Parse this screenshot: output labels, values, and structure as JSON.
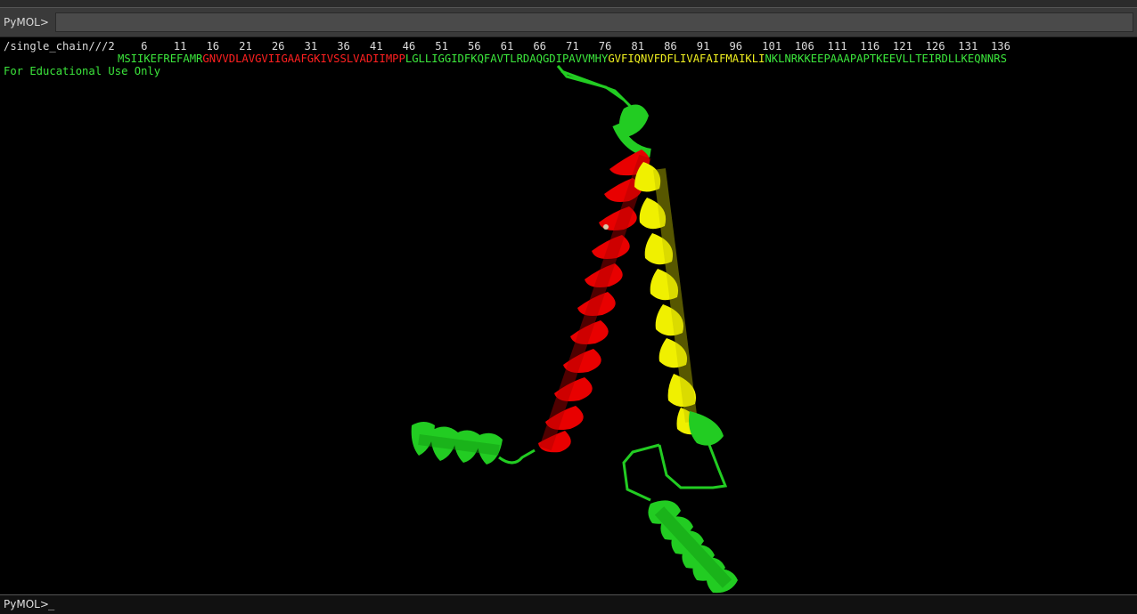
{
  "command_bar_top": {
    "prompt": "PyMOL>"
  },
  "sequence_viewer": {
    "object_label": "/single_chain///",
    "numbers": [
      "2",
      "6",
      "11",
      "16",
      "21",
      "26",
      "31",
      "36",
      "41",
      "46",
      "51",
      "56",
      "61",
      "66",
      "71",
      "76",
      "81",
      "86",
      "91",
      "96",
      "101",
      "106",
      "111",
      "116",
      "121",
      "126",
      "131",
      "136"
    ],
    "segments": [
      {
        "text": "MSIIKEFREFAMR",
        "color": "green"
      },
      {
        "text": "GNVVDLAVGVIIGAAFGKIVSSLVADIIMPP",
        "color": "red"
      },
      {
        "text": "LGLLIGGIDFKQFAVTLRDAQGDIPAVVMHY",
        "color": "green"
      },
      {
        "text": "GVFIQNVFDFLIVAFAIFMAIKLI",
        "color": "yellow"
      },
      {
        "text": "NKLNRKKEEPAAAPAPTKEEVLLTEIRDLLKEQNNRS",
        "color": "green"
      }
    ]
  },
  "watermark": "For Educational Use Only",
  "structure": {
    "representation": "cartoon",
    "colors": {
      "green": "#22cc22",
      "red": "#e80000",
      "yellow": "#f0f000",
      "background": "#000000"
    }
  },
  "command_bar_bottom": {
    "prompt": "PyMOL>",
    "cursor": "_"
  }
}
